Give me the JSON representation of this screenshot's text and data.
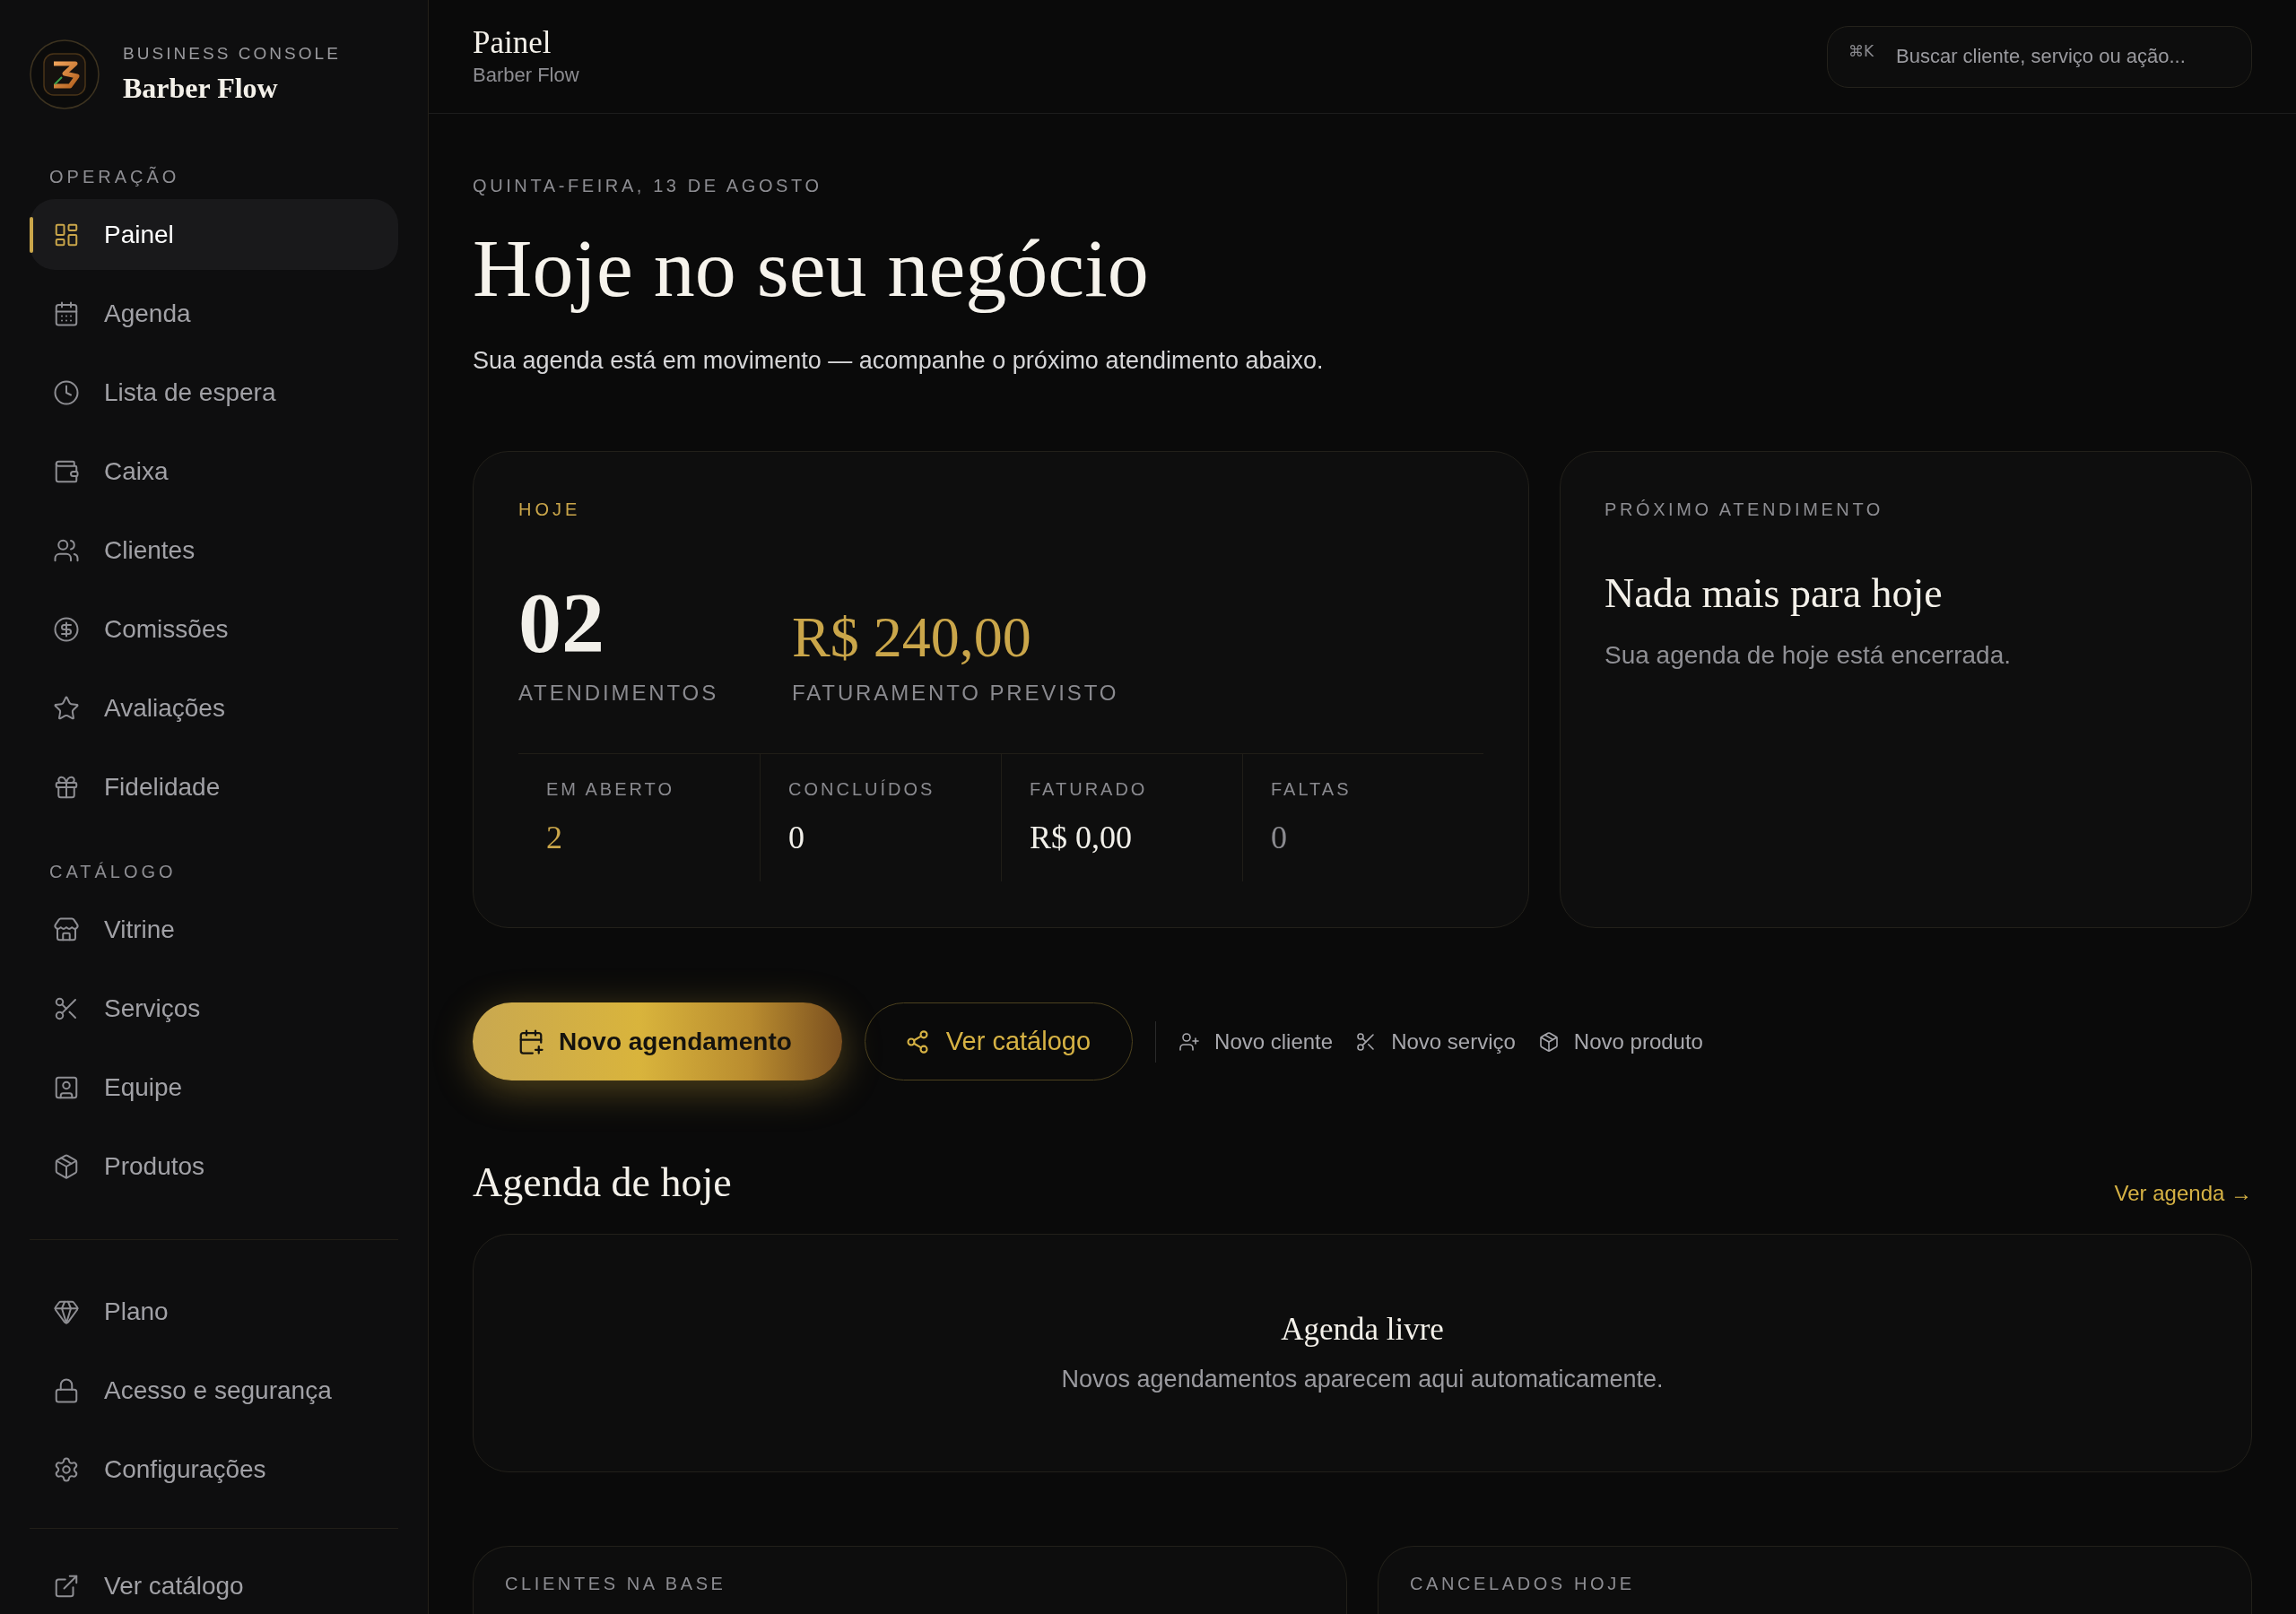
{
  "sidebar": {
    "brand": {
      "eyebrow": "BUSINESS CONSOLE",
      "name": "Barber Flow"
    },
    "sections": [
      {
        "title": "OPERAÇÃO",
        "items": [
          {
            "label": "Painel",
            "selected": true
          },
          {
            "label": "Agenda",
            "selected": false
          },
          {
            "label": "Lista de espera",
            "selected": false
          },
          {
            "label": "Caixa",
            "selected": false
          },
          {
            "label": "Clientes",
            "selected": false
          },
          {
            "label": "Comissões",
            "selected": false
          },
          {
            "label": "Avaliações",
            "selected": false
          },
          {
            "label": "Fidelidade",
            "selected": false
          }
        ]
      },
      {
        "title": "CATÁLOGO",
        "items": [
          {
            "label": "Vitrine",
            "selected": false
          },
          {
            "label": "Serviços",
            "selected": false
          },
          {
            "label": "Equipe",
            "selected": false
          },
          {
            "label": "Produtos",
            "selected": false
          }
        ]
      },
      {
        "items": [
          {
            "label": "Plano",
            "selected": false
          },
          {
            "label": "Acesso e segurança",
            "selected": false
          },
          {
            "label": "Configurações",
            "selected": false
          }
        ]
      },
      {
        "items": [
          {
            "label": "Ver catálogo",
            "selected": false
          }
        ]
      }
    ]
  },
  "header": {
    "title": "Painel",
    "subtitle": "Barber Flow",
    "search": {
      "shortcut": "⌘K",
      "placeholder": "Buscar cliente, serviço ou ação..."
    }
  },
  "intro": {
    "date": "QUINTA-FEIRA, 13 DE AGOSTO",
    "title": "Hoje no seu negócio",
    "subtitle": "Sua agenda está em movimento — acompanhe o próximo atendimento abaixo."
  },
  "today_card": {
    "label": "HOJE",
    "metrics": [
      {
        "value": "02",
        "caption": "ATENDIMENTOS",
        "color": "#f2f0ea"
      },
      {
        "value": "R$ 240,00",
        "caption": "FATURAMENTO PREVISTO",
        "color": "#caa64a"
      }
    ],
    "stats": [
      {
        "label": "EM ABERTO",
        "value": "2",
        "color": "#caa64a"
      },
      {
        "label": "CONCLUÍDOS",
        "value": "0",
        "color": "#f2f0ea"
      },
      {
        "label": "FATURADO",
        "value": "R$ 0,00",
        "color": "#f2f0ea"
      },
      {
        "label": "FALTAS",
        "value": "0",
        "color": "#8a8a8f"
      }
    ]
  },
  "next_card": {
    "label": "PRÓXIMO ATENDIMENTO",
    "title": "Nada mais para hoje",
    "text": "Sua agenda de hoje está encerrada."
  },
  "actions": [
    {
      "kind": "primary",
      "label": "Novo agendamento"
    },
    {
      "kind": "outline",
      "label": "Ver catálogo"
    },
    {
      "kind": "link",
      "label": "Novo cliente"
    },
    {
      "kind": "link",
      "label": "Novo serviço"
    },
    {
      "kind": "link",
      "label": "Novo produto"
    }
  ],
  "agenda": {
    "title": "Agenda de hoje",
    "link": "Ver agenda →",
    "empty_title": "Agenda livre",
    "empty_text": "Novos agendamentos aparecem aqui automaticamente."
  },
  "summary_cards": [
    {
      "label": "CLIENTES NA BASE"
    },
    {
      "label": "CANCELADOS HOJE"
    }
  ]
}
